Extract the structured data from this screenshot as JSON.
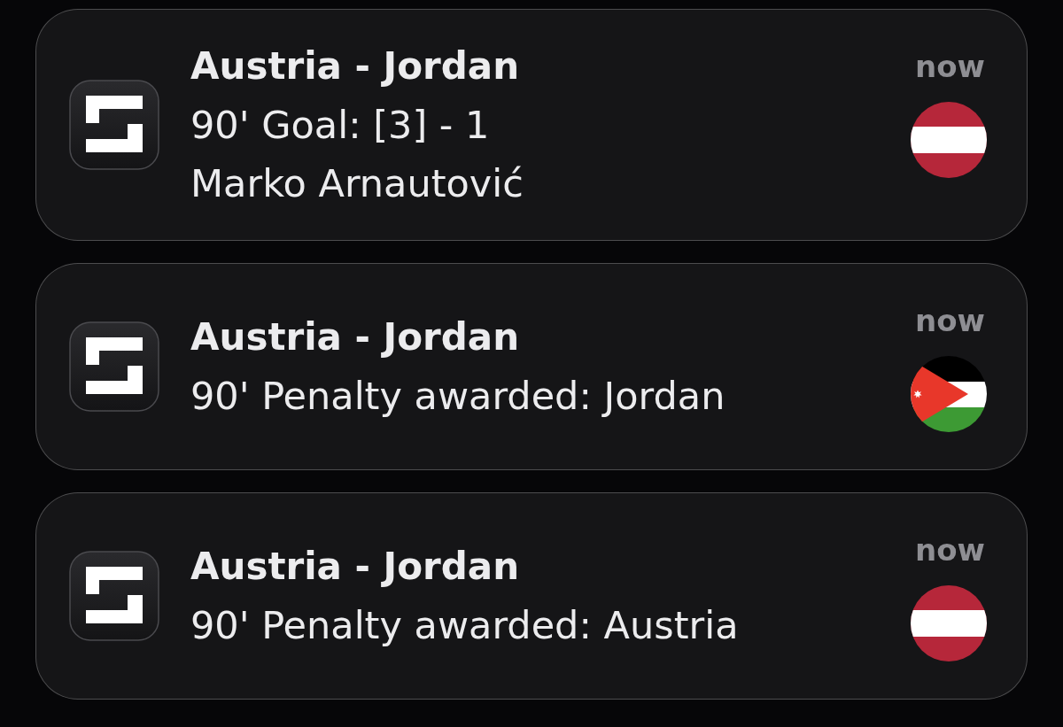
{
  "notifications": [
    {
      "title": "Austria - Jordan",
      "lines": [
        "90' Goal: [3] - 1",
        "Marko Arnautović"
      ],
      "time": "now",
      "flag": {
        "kind": "austria"
      }
    },
    {
      "title": "Austria - Jordan",
      "lines": [
        "90' Penalty awarded: Jordan"
      ],
      "time": "now",
      "flag": {
        "kind": "jordan"
      }
    },
    {
      "title": "Austria - Jordan",
      "lines": [
        "90' Penalty awarded: Austria"
      ],
      "time": "now",
      "flag": {
        "kind": "austria"
      }
    }
  ]
}
